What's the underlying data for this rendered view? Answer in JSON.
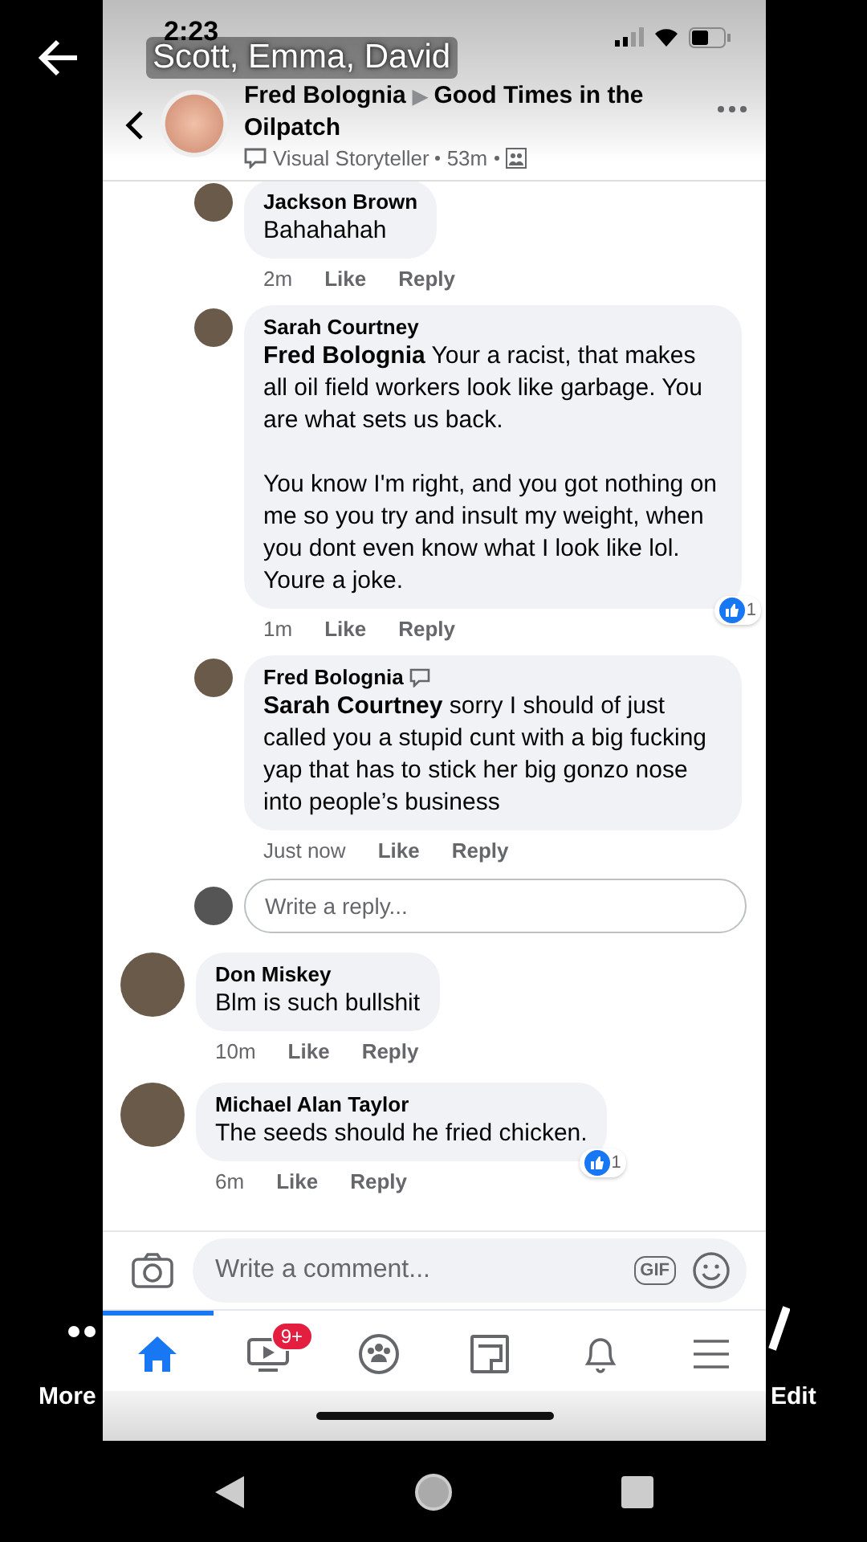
{
  "overlay": {
    "title": "Scott, Emma, David",
    "left_action": "More",
    "right_action": "Edit"
  },
  "status_bar": {
    "time": "2:23"
  },
  "post_header": {
    "author": "Fred Bolognia",
    "separator": "▶",
    "group": "Good Times in the Oilpatch",
    "role": "Visual Storyteller",
    "time": "53m"
  },
  "reply_thread": {
    "replies": [
      {
        "author": "Jackson Brown",
        "has_badge": false,
        "paragraphs": [
          "Bahahahah"
        ],
        "time": "2m",
        "like": "Like",
        "reply": "Reply"
      },
      {
        "author": "Sarah Courtney",
        "has_badge": false,
        "paragraphs": [
          "**Fred Bolognia**  Your a racist, that makes all oil field workers look like garbage. You are what sets us back.",
          "You know I'm right, and you got nothing on me so you try and insult my weight, when you dont even know what I look like lol. Youre a joke."
        ],
        "time": "1m",
        "like": "Like",
        "reply": "Reply",
        "likes": "1"
      },
      {
        "author": "Fred Bolognia",
        "has_badge": true,
        "paragraphs": [
          "**Sarah Courtney** sorry I should of just called you a stupid cunt with a big fucking yap that has to stick her big gonzo nose into people’s business"
        ],
        "time": "Just now",
        "like": "Like",
        "reply": "Reply"
      }
    ],
    "reply_field": {
      "placeholder": "Write a reply..."
    }
  },
  "comments": [
    {
      "author": "Don Miskey",
      "has_badge": false,
      "paragraphs": [
        "Blm is such bullshit"
      ],
      "time": "10m",
      "like": "Like",
      "reply": "Reply"
    },
    {
      "author": "Michael Alan Taylor",
      "has_badge": false,
      "paragraphs": [
        "The seeds should he fried chicken."
      ],
      "time": "6m",
      "like": "Like",
      "reply": "Reply",
      "likes": "1"
    }
  ],
  "comment_bar": {
    "placeholder": "Write a comment...",
    "gif_label": "GIF"
  },
  "tabs": [
    {
      "kind": "home",
      "selected": true
    },
    {
      "kind": "video",
      "selected": false,
      "badge": "9+"
    },
    {
      "kind": "groups",
      "selected": false
    },
    {
      "kind": "pages",
      "selected": false
    },
    {
      "kind": "bell",
      "selected": false
    },
    {
      "kind": "menu",
      "selected": false
    }
  ]
}
